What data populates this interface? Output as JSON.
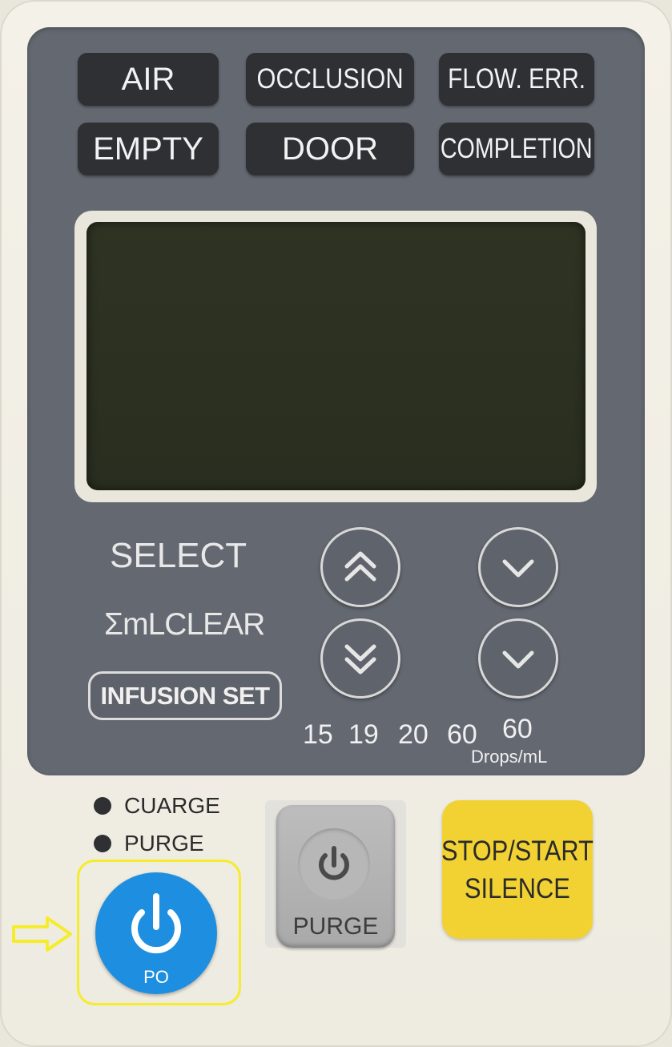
{
  "alarms": {
    "row1": [
      "AIR",
      "OCCLUSION",
      "FLOW. ERR."
    ],
    "row2": [
      "EMPTY",
      "DOOR",
      "COMPLETION"
    ]
  },
  "labels": {
    "select": "SELECT",
    "ml_clear": "ΣmLCLEAR",
    "infusion_set": "INFUSION SET"
  },
  "drop_rates": {
    "values": [
      "15",
      "19",
      "20",
      "60",
      "60"
    ],
    "unit": "Drops/mL"
  },
  "indicators": {
    "charge": "CUARGE",
    "purge": "PURGE"
  },
  "buttons": {
    "purge_label": "PURGE",
    "stop_start": "STOP/START",
    "silence": "SILENCE",
    "power_label": "PO"
  },
  "icons": {
    "up_fast": "double-chevron-up-icon",
    "down_fast": "double-chevron-down-icon",
    "down_1": "chevron-down-icon",
    "down_2": "chevron-down-icon",
    "power": "power-icon",
    "arrow": "arrow-right-icon"
  },
  "colors": {
    "panel": "#646871",
    "alarm_bg": "#2e3034",
    "lcd": "#2f3322",
    "power_blue": "#1e8ee0",
    "stop_yellow": "#f2d233",
    "highlight": "#f5ec2a"
  }
}
